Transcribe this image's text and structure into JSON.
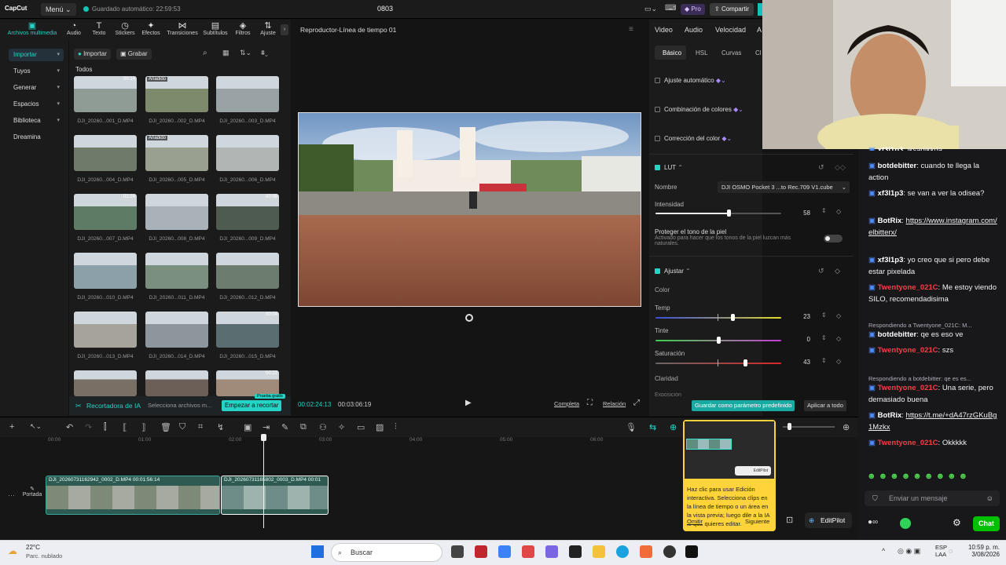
{
  "titlebar": {
    "logo": "CapCut",
    "menu": "Menú",
    "autosave": "Guardado automático: 22:59:53",
    "project": "0803",
    "pro": "Pro",
    "share": "Compartir"
  },
  "media_tabs": [
    "Archivos multimedia",
    "Audio",
    "Texto",
    "Stickers",
    "Efectos",
    "Transiciones",
    "Subtítulos",
    "Filtros",
    "Ajuste"
  ],
  "sidebar": [
    "Importar",
    "Tuyos",
    "Generar",
    "Espacios",
    "Biblioteca",
    "Dreamina"
  ],
  "media": {
    "import": "Importar",
    "record": "Grabar",
    "all": "Todos",
    "clips": [
      {
        "name": "DJI_20260...001_D.MP4",
        "tag": "",
        "dur": "00:14"
      },
      {
        "name": "DJI_20260...002_D.MP4",
        "tag": "Añadido",
        "dur": ""
      },
      {
        "name": "DJI_20260...003_D.MP4",
        "tag": "",
        "dur": ""
      },
      {
        "name": "DJI_20260...004_D.MP4",
        "tag": "",
        "dur": ""
      },
      {
        "name": "DJI_20260...005_D.MP4",
        "tag": "Añadido",
        "dur": ""
      },
      {
        "name": "DJI_20260...006_D.MP4",
        "tag": "",
        "dur": ""
      },
      {
        "name": "DJI_20260...007_D.MP4",
        "tag": "",
        "dur": "01:24"
      },
      {
        "name": "DJI_20260...008_D.MP4",
        "tag": "",
        "dur": ""
      },
      {
        "name": "DJI_20260...009_D.MP4",
        "tag": "",
        "dur": "00:08"
      },
      {
        "name": "DJI_20260...010_D.MP4",
        "tag": "",
        "dur": ""
      },
      {
        "name": "DJI_20260...011_D.MP4",
        "tag": "",
        "dur": ""
      },
      {
        "name": "DJI_20260...012_D.MP4",
        "tag": "",
        "dur": ""
      },
      {
        "name": "DJI_20260...013_D.MP4",
        "tag": "",
        "dur": ""
      },
      {
        "name": "DJI_20260...014_D.MP4",
        "tag": "",
        "dur": ""
      },
      {
        "name": "DJI_20260...015_D.MP4",
        "tag": "",
        "dur": "00:04"
      },
      {
        "name": "",
        "tag": "",
        "dur": ""
      },
      {
        "name": "",
        "tag": "",
        "dur": ""
      },
      {
        "name": "",
        "tag": "",
        "dur": "00:22"
      }
    ],
    "ai_cutter": "Recortadora de IA",
    "ai_hint": "Selecciona archivos m...",
    "ai_button": "Empezar a recortar",
    "ai_badge": "Prueba gratis"
  },
  "player": {
    "title": "Reproductor-Línea de tiempo 01",
    "current": "00:02:24:13",
    "total": "00:03:06:19",
    "full": "Completa",
    "ratio": "Relación"
  },
  "inspector": {
    "tabs": [
      "Video",
      "Audio",
      "Velocidad",
      "A"
    ],
    "subtabs": [
      "Básico",
      "HSL",
      "Curvas",
      "Cl"
    ],
    "auto_adjust": "Ajuste automático",
    "color_match": "Combinación de colores",
    "color_correction": "Corrección del color",
    "lut": "LUT",
    "name_label": "Nombre",
    "lut_name": "DJI OSMO Pocket 3 ...to Rec.709 V1.cube",
    "intensity_label": "Intensidad",
    "intensity": "58",
    "intensity_frac": 0.58,
    "skin_title": "Proteger el tono de la piel",
    "skin_desc": "Activado para hacer que los tonos de la piel luzcan más naturales.",
    "adjust": "Ajustar",
    "color": "Color",
    "temp_label": "Temp",
    "temp": "23",
    "temp_frac": 0.615,
    "tint_label": "Tinte",
    "tint": "0",
    "tint_frac": 0.5,
    "sat_label": "Saturación",
    "sat": "43",
    "sat_frac": 0.715,
    "clarity": "Claridad",
    "exposure": "Exposición",
    "save_preset": "Guardar como parámetro predefinido",
    "apply_all": "Aplicar a todo"
  },
  "timeline": {
    "ticks": [
      "00:00",
      "01:00",
      "02:00",
      "03:00",
      "04:00",
      "05:00",
      "06:00"
    ],
    "cover": "Portada",
    "clip1": "DJI_20260731162942_0002_D.MP4  00:01:56:14",
    "clip2": "DJI_20260731165802_0003_D.MP4  00:01"
  },
  "editpilot": {
    "tip": "Haz clic para usar Edición interactiva. Selecciona clips en la línea de tiempo o un área en la vista previa; luego dile a la IA lo que quieres editar.",
    "omit": "Omitir",
    "next": "Siguiente",
    "button": "EditPilot"
  },
  "chat": {
    "messages": [
      {
        "user": "xf3l1p3",
        "text": "jksadjkkda",
        "color": "#ffffff"
      },
      {
        "user": "botdebitter",
        "text": "cuando te llega la action",
        "color": "#ffffff"
      },
      {
        "user": "xf3l1p3",
        "text": "se van a ver la odisea?",
        "color": "#ffffff"
      },
      {
        "user": "BotRix",
        "text": "https://www.instagram.com/elbitterx/",
        "color": "#ffffff"
      },
      {
        "user": "xf3l1p3",
        "text": "yo creo que si pero debe estar pixelada",
        "color": "#ffffff"
      },
      {
        "user": "Twentyone_021C",
        "text": "Me estoy viendo SILO, recomendadisima",
        "color": "#ff3b47"
      },
      {
        "user": "botdebitter",
        "text": "qe es eso ve",
        "color": "#ffffff"
      },
      {
        "user": "Twentyone_021C",
        "text": "szs",
        "color": "#ff3b47"
      },
      {
        "user": "Twentyone_021C",
        "text": "Una serie, pero demasiado buena",
        "color": "#ff3b47"
      },
      {
        "user": "BotRix",
        "text": "https://t.me/+dA47rzGKuBg1Mzkx",
        "color": "#ffffff"
      },
      {
        "user": "Twentyone_021C",
        "text": "Okkkkk",
        "color": "#ff3b47"
      }
    ],
    "reply1": "Respondiendo a Twentyone_021C: M...",
    "reply2": "Respondiendo a botdebitter: qe es es...",
    "placeholder": "Enviar un mensaje",
    "send": "Chat"
  },
  "taskbar": {
    "temp": "22°C",
    "weather": "Parc. nublado",
    "search": "Buscar",
    "lang1": "ESP",
    "lang2": "LAA",
    "time": "10:59 p. m.",
    "date": "3/08/2026"
  },
  "colors": {
    "accent": "#25d4c6",
    "tip": "#ffd43b",
    "chat_green": "#00c000"
  }
}
